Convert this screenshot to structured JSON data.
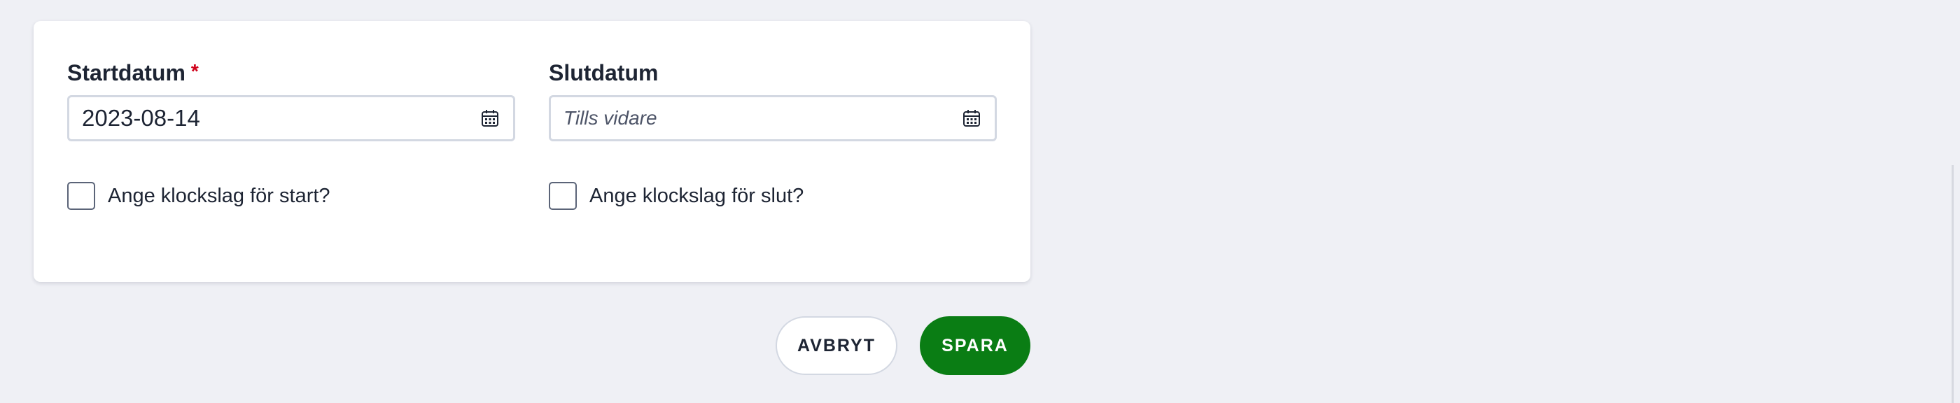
{
  "form": {
    "start": {
      "label": "Startdatum",
      "required_mark": "*",
      "value": "2023-08-14",
      "checkbox_label": "Ange klockslag för start?",
      "checked": false
    },
    "end": {
      "label": "Slutdatum",
      "placeholder": "Tills vidare",
      "value": "",
      "checkbox_label": "Ange klockslag för slut?",
      "checked": false
    }
  },
  "actions": {
    "cancel_label": "AVBRYT",
    "save_label": "SPARA"
  },
  "colors": {
    "page_background": "#eff0f5",
    "card_background": "#ffffff",
    "required_mark": "#d0021b",
    "save_button": "#0a7d14",
    "text": "#1d2433",
    "input_border": "#d3d8e2"
  },
  "icons": {
    "date_picker": "calendar-icon"
  }
}
